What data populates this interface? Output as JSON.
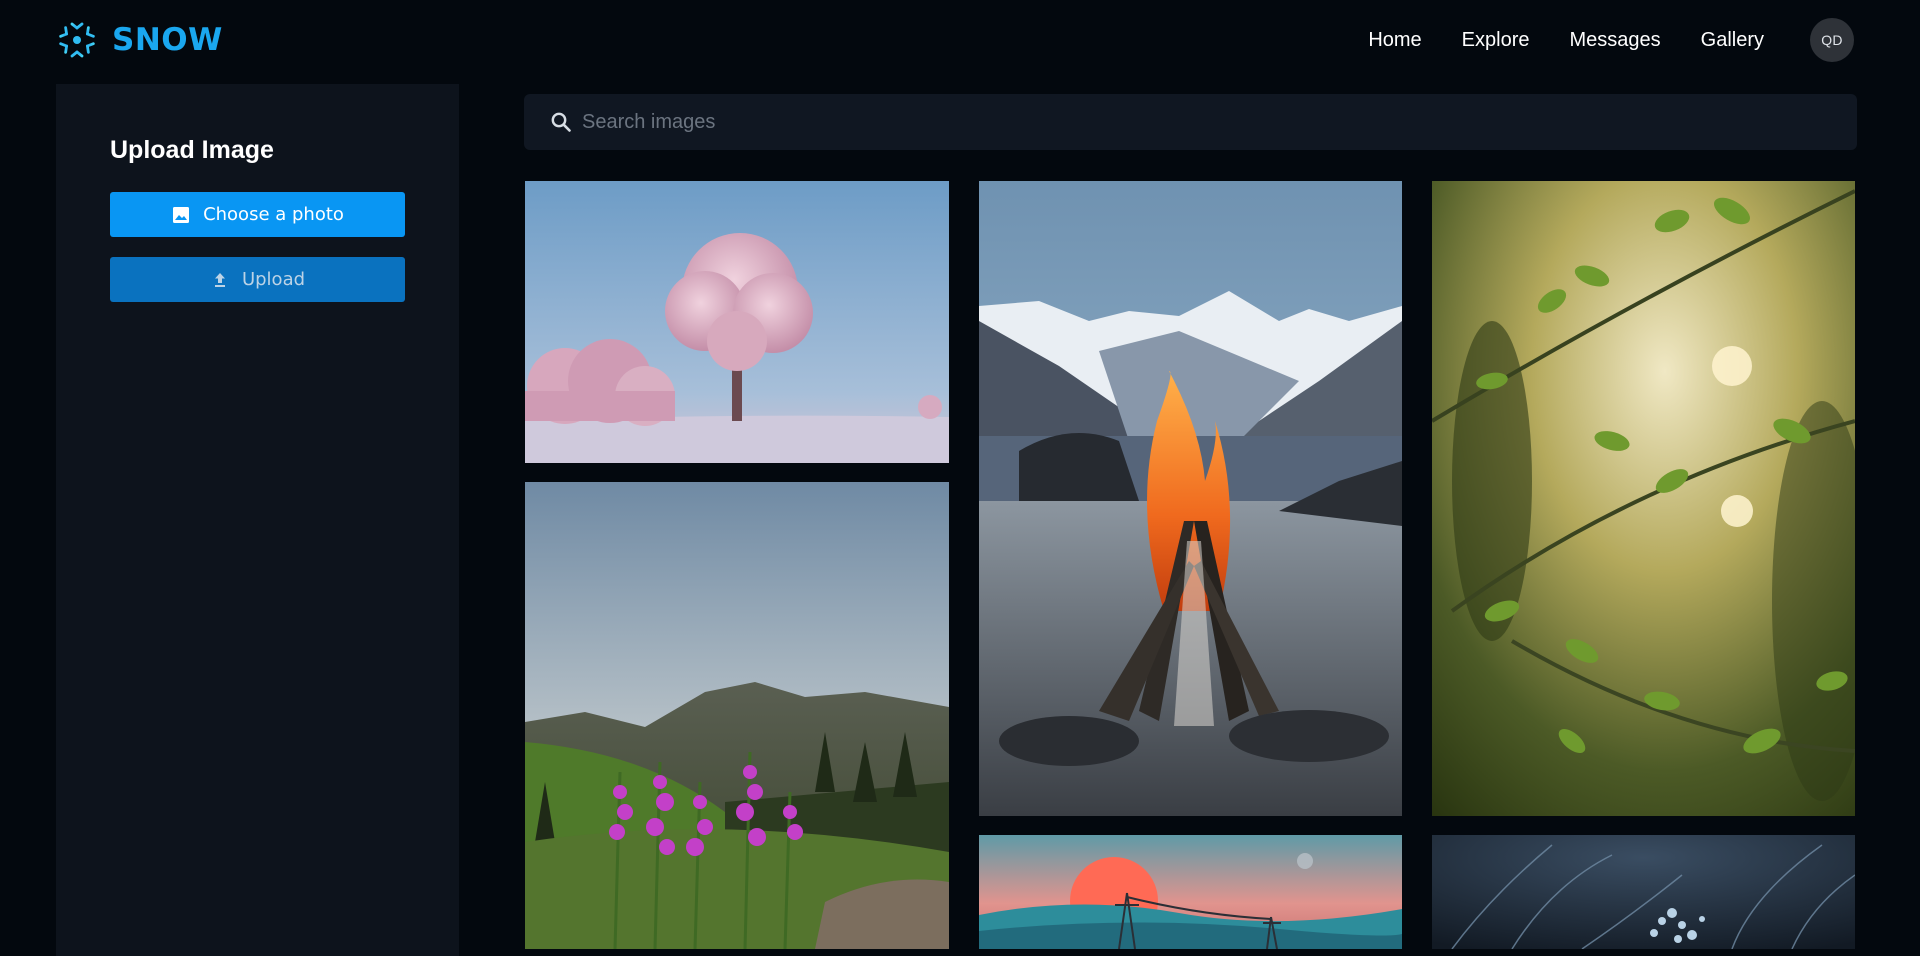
{
  "app": {
    "name": "SNOW",
    "logo_icon": "snowflake-icon",
    "brand_color": "#1aa7ef"
  },
  "nav": {
    "items": [
      {
        "label": "Home"
      },
      {
        "label": "Explore"
      },
      {
        "label": "Messages"
      },
      {
        "label": "Gallery"
      }
    ],
    "avatar_initials": "QD"
  },
  "sidebar": {
    "title": "Upload Image",
    "choose_label": "Choose a photo",
    "choose_icon": "image-icon",
    "upload_label": "Upload",
    "upload_icon": "upload-arrow-icon"
  },
  "search": {
    "placeholder": "Search images",
    "value": "",
    "icon": "search-icon"
  },
  "gallery": {
    "images": [
      {
        "subject": "pink frosted tree in snow",
        "icon": "photo-snow-tree"
      },
      {
        "subject": "campfire by mountain lake",
        "icon": "photo-campfire"
      },
      {
        "subject": "green leaves with sunlight",
        "icon": "photo-leaves"
      },
      {
        "subject": "mountains with pink wildflowers",
        "icon": "photo-wildflowers"
      },
      {
        "subject": "red sun over hills with power lines",
        "icon": "photo-sunset"
      },
      {
        "subject": "dark blue frosted plants",
        "icon": "photo-frost"
      }
    ]
  },
  "colors": {
    "background": "#03080e",
    "sidebar": "#0d131c",
    "search_bg": "#101722",
    "primary_button": "#0996f3",
    "secondary_button": "#0a72bf"
  }
}
